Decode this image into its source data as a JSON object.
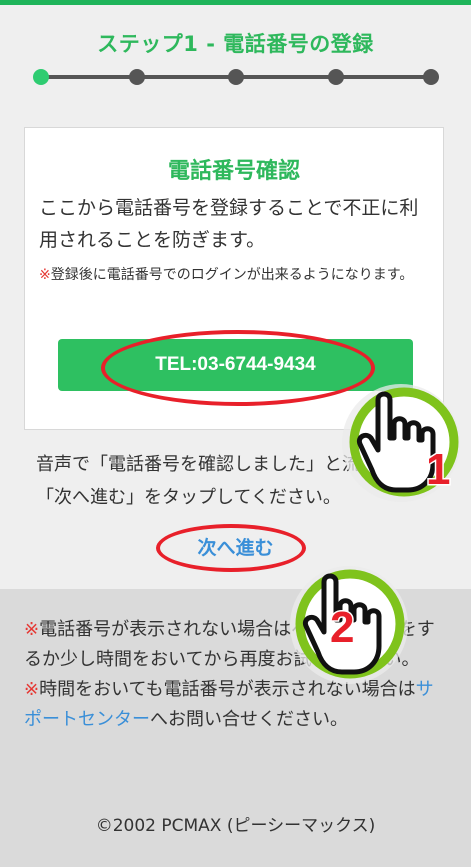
{
  "step": {
    "title": "ステップ1 - 電話番号の登録",
    "total_steps": 5,
    "current_step": 1
  },
  "card": {
    "title": "電話番号確認",
    "description": "ここから電話番号を登録することで不正に利用されることを防ぎます。",
    "note_mark": "※",
    "note_text": "登録後に電話番号でのログインが出来るようになります。",
    "tel_button_label": "TEL:03-6744-9434"
  },
  "instruction": "音声で「電話番号を確認しました」と流れたら「次へ進む」をタップしてください。",
  "next_link_label": "次へ進む",
  "notes": {
    "mark1": "※",
    "text1": "電話番号が表示されない場合はページの更新をするか少し時間をおいてから再度お試しください。",
    "mark2": "※",
    "text2_before": "時間をおいても電話番号が表示されない場合は",
    "text2_link": "サポートセンター",
    "text2_after": "へお問い合せください。"
  },
  "copyright": "©2002 PCMAX (ピーシーマックス)",
  "annotations": {
    "badge1": "1",
    "badge2": "2"
  },
  "colors": {
    "accent_green": "#2eb85c",
    "button_green": "#2ec061",
    "link_blue": "#3a8fd8",
    "warning_red": "#e53935",
    "annotation_red": "#e8202a"
  }
}
